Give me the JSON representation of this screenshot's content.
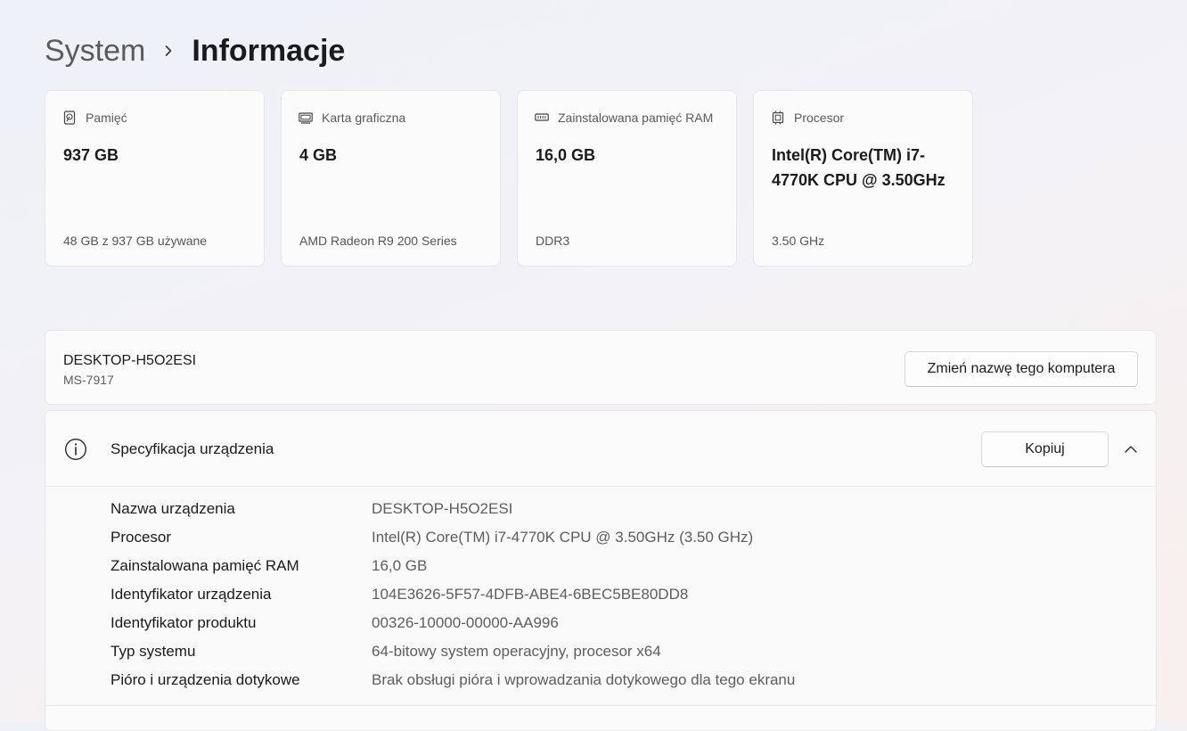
{
  "breadcrumb": {
    "parent": "System",
    "current": "Informacje"
  },
  "cards": [
    {
      "icon": "storage-icon",
      "label": "Pamięć",
      "value": "937 GB",
      "sub": "48 GB z 937 GB używane"
    },
    {
      "icon": "graphics-card-icon",
      "label": "Karta graficzna",
      "value": "4 GB",
      "sub": "AMD Radeon R9 200 Series"
    },
    {
      "icon": "ram-icon",
      "label": "Zainstalowana pamięć RAM",
      "value": "16,0 GB",
      "sub": "DDR3"
    },
    {
      "icon": "processor-icon",
      "label": "Procesor",
      "value": "Intel(R) Core(TM) i7-4770K CPU @ 3.50GHz",
      "sub": "3.50 GHz"
    }
  ],
  "device": {
    "name": "DESKTOP-H5O2ESI",
    "model": "MS-7917",
    "rename_label": "Zmień nazwę tego komputera"
  },
  "spec": {
    "title": "Specyfikacja urządzenia",
    "copy_label": "Kopiuj",
    "rows": [
      {
        "key": "Nazwa urządzenia",
        "value": "DESKTOP-H5O2ESI"
      },
      {
        "key": "Procesor",
        "value": "Intel(R) Core(TM) i7-4770K CPU @ 3.50GHz (3.50 GHz)"
      },
      {
        "key": "Zainstalowana pamięć RAM",
        "value": "16,0 GB"
      },
      {
        "key": "Identyfikator urządzenia",
        "value": "104E3626-5F57-4DFB-ABE4-6BEC5BE80DD8"
      },
      {
        "key": "Identyfikator produktu",
        "value": "00326-10000-00000-AA996"
      },
      {
        "key": "Typ systemu",
        "value": "64-bitowy system operacyjny, procesor x64"
      },
      {
        "key": "Pióro i urządzenia dotykowe",
        "value": "Brak obsługi pióra i wprowadzania dotykowego dla tego ekranu"
      }
    ]
  },
  "colors": {
    "background_start": "#eef1f8",
    "background_end": "#f8f0ec",
    "card_background": "#fbfbfc",
    "text_primary": "#1b1b1b",
    "text_secondary": "#5e5e5e"
  }
}
